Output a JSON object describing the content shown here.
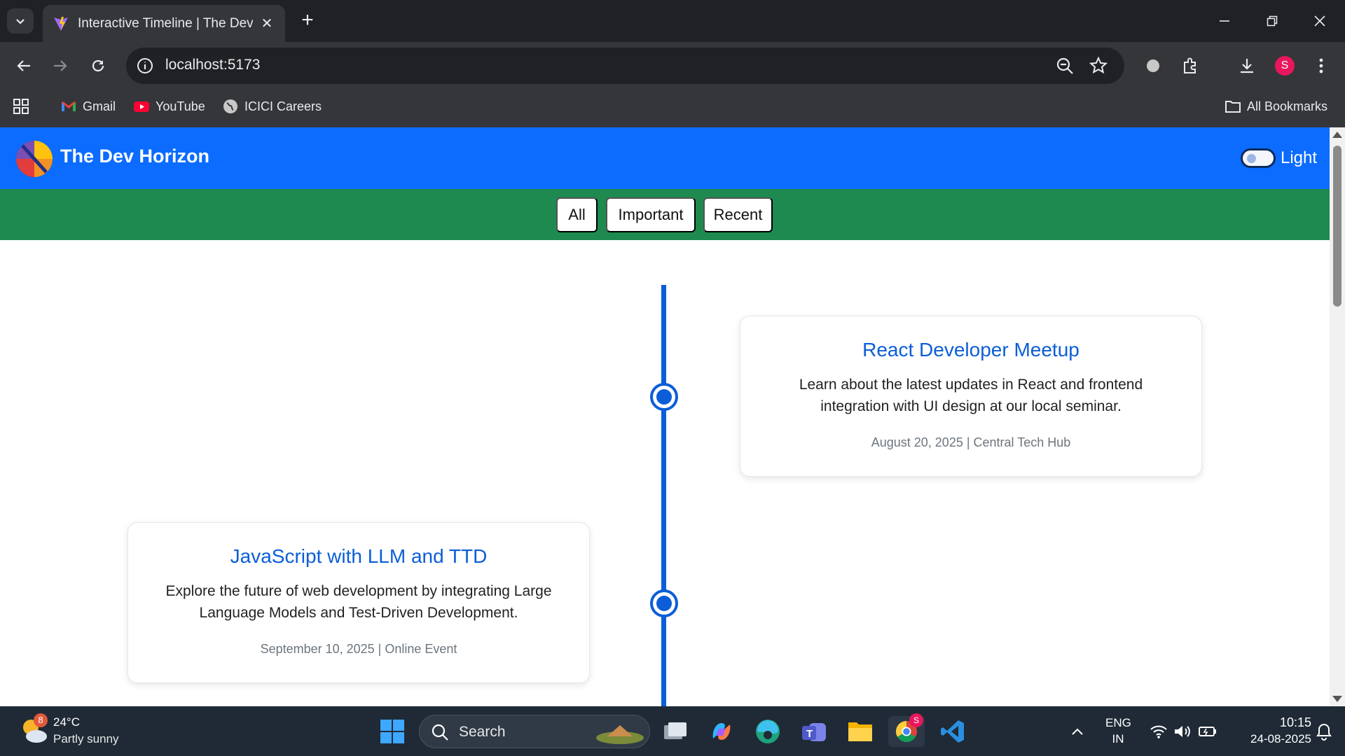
{
  "browser": {
    "tab": {
      "title": "Interactive Timeline | The Dev Horizon"
    },
    "url": "localhost:5173",
    "profile_initial": "S",
    "bookmarks": [
      {
        "label": "Gmail",
        "icon": "gmail-icon"
      },
      {
        "label": "YouTube",
        "icon": "youtube-icon"
      },
      {
        "label": "ICICI Careers",
        "icon": "globe-icon"
      }
    ],
    "all_bookmarks_label": "All Bookmarks"
  },
  "app": {
    "brand": "The Dev Horizon",
    "theme_label": "Light",
    "theme_toggle_on": false,
    "colors": {
      "header": "#0b6cff",
      "filterbar": "#1e8a4f",
      "accent": "#0b5ed7"
    },
    "filters": [
      "All",
      "Important",
      "Recent"
    ],
    "events": [
      {
        "title": "React Developer Meetup",
        "description": "Learn about the latest updates in React and frontend integration with UI design at our local seminar.",
        "meta": "August 20, 2025 | Central Tech Hub"
      },
      {
        "title": "JavaScript with LLM and TTD",
        "description": "Explore the future of web development by integrating Large Language Models and Test-Driven Development.",
        "meta": "September 10, 2025 | Online Event"
      }
    ]
  },
  "taskbar": {
    "weather": {
      "temp": "24°C",
      "desc": "Partly sunny",
      "badge": "8"
    },
    "search_label": "Search",
    "chrome_badge": "S",
    "lang_top": "ENG",
    "lang_bottom": "IN",
    "time": "10:15",
    "date": "24-08-2025"
  }
}
